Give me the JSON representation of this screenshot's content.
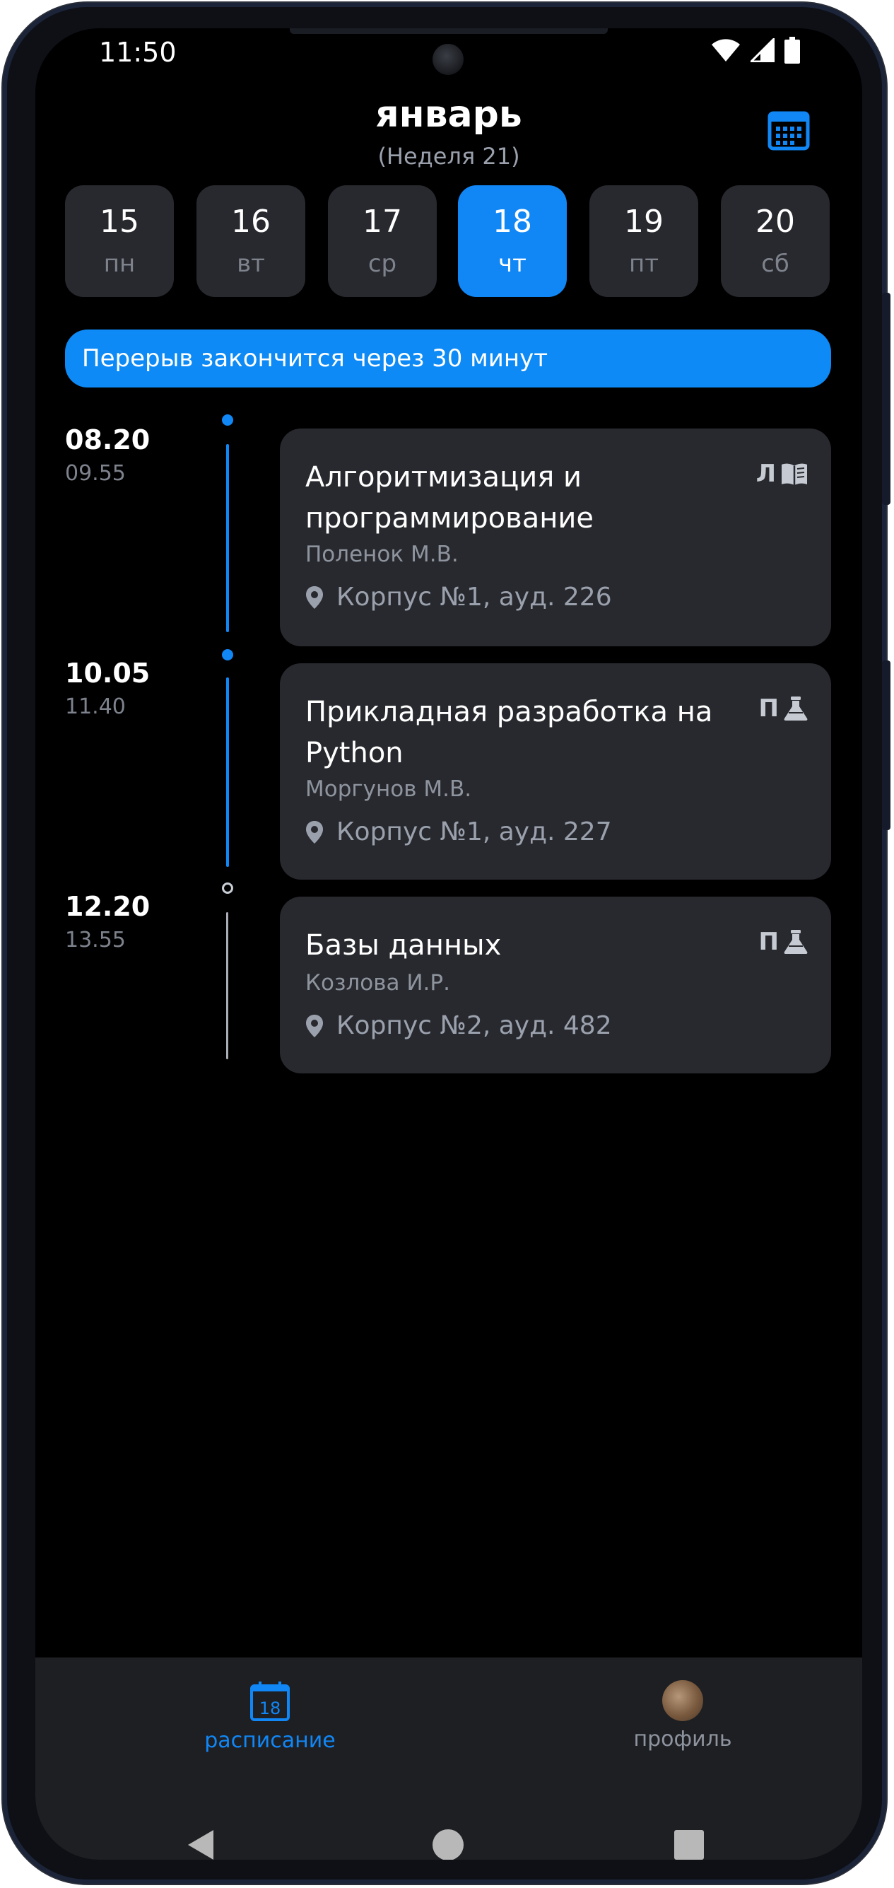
{
  "status_bar": {
    "time": "11:50",
    "wifi_icon": "wifi-icon",
    "signal_icon": "signal-icon",
    "battery_icon": "battery-icon"
  },
  "header": {
    "month": "январь",
    "week": "(Неделя 21)",
    "calendar_icon": "calendar-grid-icon"
  },
  "days": [
    {
      "num": "15",
      "weekday": "пн",
      "active": false
    },
    {
      "num": "16",
      "weekday": "вт",
      "active": false
    },
    {
      "num": "17",
      "weekday": "ср",
      "active": false
    },
    {
      "num": "18",
      "weekday": "чт",
      "active": true
    },
    {
      "num": "19",
      "weekday": "пт",
      "active": false
    },
    {
      "num": "20",
      "weekday": "сб",
      "active": false
    }
  ],
  "banner": {
    "text": "Перерыв закончится через 30 минут"
  },
  "lessons": [
    {
      "start": "08.20",
      "end": "09.55",
      "title": "Алгоритмизация и программирование",
      "teacher": "Поленок М.В.",
      "room": "Корпус №1, ауд. 226",
      "type": "Л",
      "type_icon": "book-icon"
    },
    {
      "start": "10.05",
      "end": "11.40",
      "title": "Прикладная разработка на Python",
      "teacher": "Моргунов М.В.",
      "room": "Корпус №1, ауд. 227",
      "type": "П",
      "type_icon": "flask-icon"
    },
    {
      "start": "12.20",
      "end": "13.55",
      "title": "Базы данных",
      "teacher": "Козлова И.Р.",
      "room": "Корпус №2, ауд. 482",
      "type": "П",
      "type_icon": "flask-icon"
    }
  ],
  "bottom_nav": {
    "schedule": {
      "label": "расписание",
      "icon_day": "18"
    },
    "profile": {
      "label": "профиль"
    }
  },
  "colors": {
    "accent": "#1187f6",
    "card": "#28292e",
    "background": "#000000"
  }
}
